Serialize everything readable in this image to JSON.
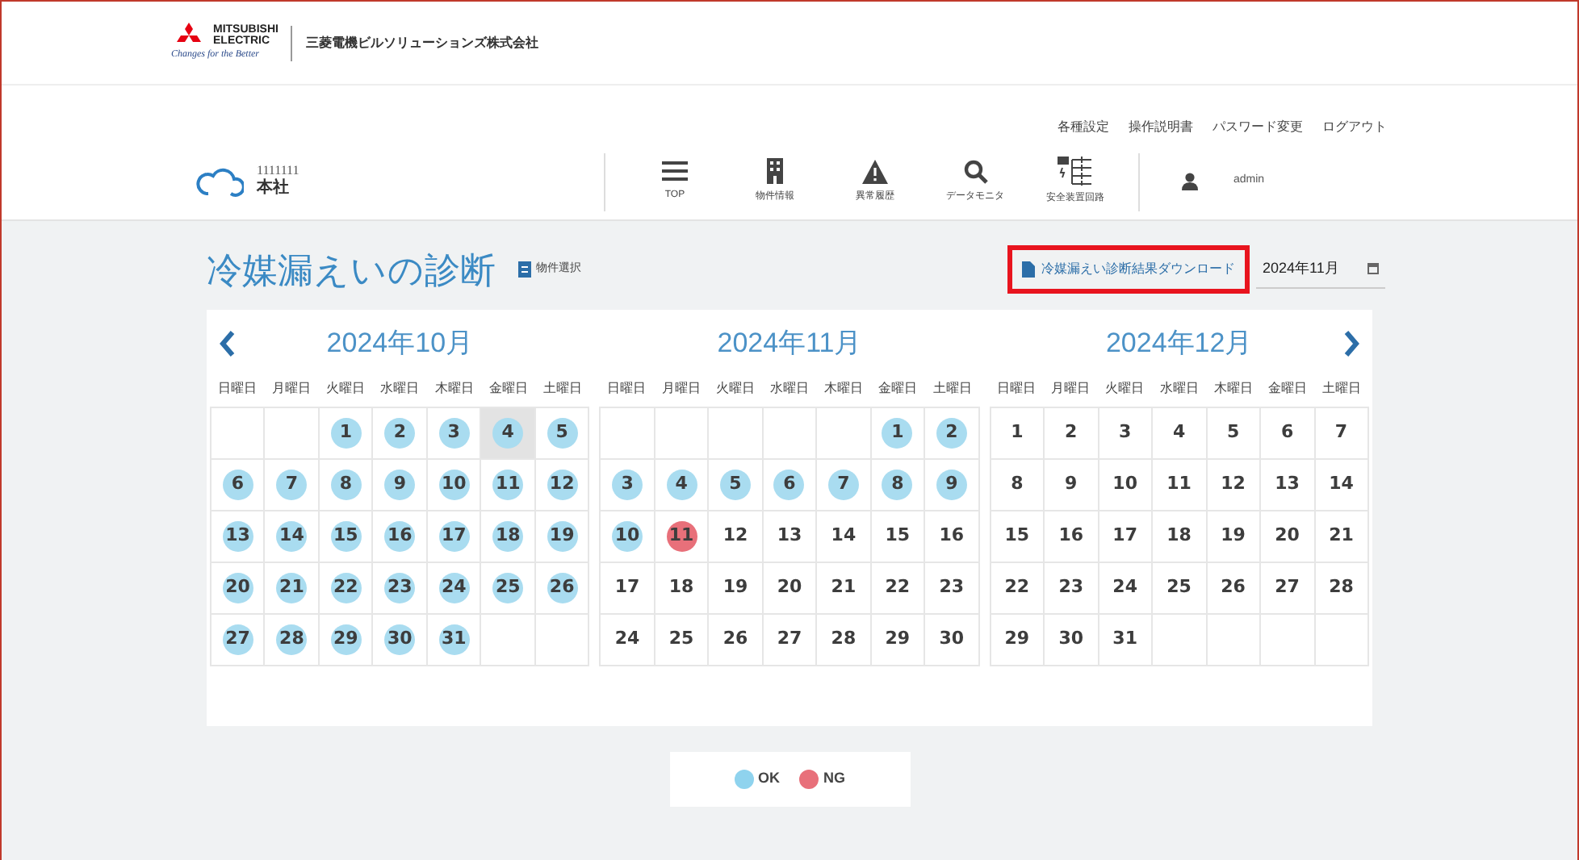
{
  "header": {
    "brand_line1": "MITSUBISHI",
    "brand_line2": "ELECTRIC",
    "tagline": "Changes for the Better",
    "company": "三菱電機ビルソリューションズ株式会社"
  },
  "top_links": [
    "各種設定",
    "操作説明書",
    "パスワード変更",
    "ログアウト"
  ],
  "site": {
    "code": "1111111",
    "name": "本社"
  },
  "nav": [
    {
      "label": "TOP",
      "kind": "menu"
    },
    {
      "label": "物件情報",
      "kind": "building"
    },
    {
      "label": "異常履歴",
      "kind": "alert"
    },
    {
      "label": "データモニタ",
      "kind": "search"
    },
    {
      "label": "安全装置回路",
      "kind": "circuit"
    }
  ],
  "user": "admin",
  "page_title": "冷媒漏えいの診断",
  "property_select": "物件選択",
  "download": "冷媒漏えい診断結果ダウンロード",
  "month_field": "2024年11月",
  "months": [
    {
      "title": "2024年10月",
      "weekdays": [
        "日曜日",
        "月曜日",
        "火曜日",
        "水曜日",
        "木曜日",
        "金曜日",
        "土曜日"
      ],
      "days": [
        {
          "kind": "blank",
          "selected": false
        },
        {
          "kind": "blank",
          "selected": false
        },
        {
          "d": "1",
          "kind": "ok",
          "selected": false
        },
        {
          "d": "2",
          "kind": "ok",
          "selected": false
        },
        {
          "d": "3",
          "kind": "ok",
          "selected": false
        },
        {
          "d": "4",
          "kind": "ok",
          "selected": true
        },
        {
          "d": "5",
          "kind": "ok",
          "selected": false
        },
        {
          "d": "6",
          "kind": "ok",
          "selected": false
        },
        {
          "d": "7",
          "kind": "ok",
          "selected": false
        },
        {
          "d": "8",
          "kind": "ok",
          "selected": false
        },
        {
          "d": "9",
          "kind": "ok",
          "selected": false
        },
        {
          "d": "10",
          "kind": "ok",
          "selected": false
        },
        {
          "d": "11",
          "kind": "ok",
          "selected": false
        },
        {
          "d": "12",
          "kind": "ok",
          "selected": false
        },
        {
          "d": "13",
          "kind": "ok",
          "selected": false
        },
        {
          "d": "14",
          "kind": "ok",
          "selected": false
        },
        {
          "d": "15",
          "kind": "ok",
          "selected": false
        },
        {
          "d": "16",
          "kind": "ok",
          "selected": false
        },
        {
          "d": "17",
          "kind": "ok",
          "selected": false
        },
        {
          "d": "18",
          "kind": "ok",
          "selected": false
        },
        {
          "d": "19",
          "kind": "ok",
          "selected": false
        },
        {
          "d": "20",
          "kind": "ok",
          "selected": false
        },
        {
          "d": "21",
          "kind": "ok",
          "selected": false
        },
        {
          "d": "22",
          "kind": "ok",
          "selected": false
        },
        {
          "d": "23",
          "kind": "ok",
          "selected": false
        },
        {
          "d": "24",
          "kind": "ok",
          "selected": false
        },
        {
          "d": "25",
          "kind": "ok",
          "selected": false
        },
        {
          "d": "26",
          "kind": "ok",
          "selected": false
        },
        {
          "d": "27",
          "kind": "ok",
          "selected": false
        },
        {
          "d": "28",
          "kind": "ok",
          "selected": false
        },
        {
          "d": "29",
          "kind": "ok",
          "selected": false
        },
        {
          "d": "30",
          "kind": "ok",
          "selected": false
        },
        {
          "d": "31",
          "kind": "ok",
          "selected": false
        }
      ]
    },
    {
      "title": "2024年11月",
      "weekdays": [
        "日曜日",
        "月曜日",
        "火曜日",
        "水曜日",
        "木曜日",
        "金曜日",
        "土曜日"
      ],
      "days": [
        {
          "kind": "blank",
          "selected": false
        },
        {
          "kind": "blank",
          "selected": false
        },
        {
          "kind": "blank",
          "selected": false
        },
        {
          "kind": "blank",
          "selected": false
        },
        {
          "kind": "blank",
          "selected": false
        },
        {
          "d": "1",
          "kind": "ok",
          "selected": false
        },
        {
          "d": "2",
          "kind": "ok",
          "selected": false
        },
        {
          "d": "3",
          "kind": "ok",
          "selected": false
        },
        {
          "d": "4",
          "kind": "ok",
          "selected": false
        },
        {
          "d": "5",
          "kind": "ok",
          "selected": false
        },
        {
          "d": "6",
          "kind": "ok",
          "selected": false
        },
        {
          "d": "7",
          "kind": "ok",
          "selected": false
        },
        {
          "d": "8",
          "kind": "ok",
          "selected": false
        },
        {
          "d": "9",
          "kind": "ok",
          "selected": false
        },
        {
          "d": "10",
          "kind": "ok",
          "selected": false
        },
        {
          "d": "11",
          "kind": "ng",
          "selected": false
        },
        {
          "d": "12",
          "kind": "plain",
          "selected": false
        },
        {
          "d": "13",
          "kind": "plain",
          "selected": false
        },
        {
          "d": "14",
          "kind": "plain",
          "selected": false
        },
        {
          "d": "15",
          "kind": "plain",
          "selected": false
        },
        {
          "d": "16",
          "kind": "plain",
          "selected": false
        },
        {
          "d": "17",
          "kind": "plain",
          "selected": false
        },
        {
          "d": "18",
          "kind": "plain",
          "selected": false
        },
        {
          "d": "19",
          "kind": "plain",
          "selected": false
        },
        {
          "d": "20",
          "kind": "plain",
          "selected": false
        },
        {
          "d": "21",
          "kind": "plain",
          "selected": false
        },
        {
          "d": "22",
          "kind": "plain",
          "selected": false
        },
        {
          "d": "23",
          "kind": "plain",
          "selected": false
        },
        {
          "d": "24",
          "kind": "plain",
          "selected": false
        },
        {
          "d": "25",
          "kind": "plain",
          "selected": false
        },
        {
          "d": "26",
          "kind": "plain",
          "selected": false
        },
        {
          "d": "27",
          "kind": "plain",
          "selected": false
        },
        {
          "d": "28",
          "kind": "plain",
          "selected": false
        },
        {
          "d": "29",
          "kind": "plain",
          "selected": false
        },
        {
          "d": "30",
          "kind": "plain",
          "selected": false
        }
      ]
    },
    {
      "title": "2024年12月",
      "weekdays": [
        "日曜日",
        "月曜日",
        "火曜日",
        "水曜日",
        "木曜日",
        "金曜日",
        "土曜日"
      ],
      "days": [
        {
          "d": "1",
          "kind": "plain",
          "selected": false
        },
        {
          "d": "2",
          "kind": "plain",
          "selected": false
        },
        {
          "d": "3",
          "kind": "plain",
          "selected": false
        },
        {
          "d": "4",
          "kind": "plain",
          "selected": false
        },
        {
          "d": "5",
          "kind": "plain",
          "selected": false
        },
        {
          "d": "6",
          "kind": "plain",
          "selected": false
        },
        {
          "d": "7",
          "kind": "plain",
          "selected": false
        },
        {
          "d": "8",
          "kind": "plain",
          "selected": false
        },
        {
          "d": "9",
          "kind": "plain",
          "selected": false
        },
        {
          "d": "10",
          "kind": "plain",
          "selected": false
        },
        {
          "d": "11",
          "kind": "plain",
          "selected": false
        },
        {
          "d": "12",
          "kind": "plain",
          "selected": false
        },
        {
          "d": "13",
          "kind": "plain",
          "selected": false
        },
        {
          "d": "14",
          "kind": "plain",
          "selected": false
        },
        {
          "d": "15",
          "kind": "plain",
          "selected": false
        },
        {
          "d": "16",
          "kind": "plain",
          "selected": false
        },
        {
          "d": "17",
          "kind": "plain",
          "selected": false
        },
        {
          "d": "18",
          "kind": "plain",
          "selected": false
        },
        {
          "d": "19",
          "kind": "plain",
          "selected": false
        },
        {
          "d": "20",
          "kind": "plain",
          "selected": false
        },
        {
          "d": "21",
          "kind": "plain",
          "selected": false
        },
        {
          "d": "22",
          "kind": "plain",
          "selected": false
        },
        {
          "d": "23",
          "kind": "plain",
          "selected": false
        },
        {
          "d": "24",
          "kind": "plain",
          "selected": false
        },
        {
          "d": "25",
          "kind": "plain",
          "selected": false
        },
        {
          "d": "26",
          "kind": "plain",
          "selected": false
        },
        {
          "d": "27",
          "kind": "plain",
          "selected": false
        },
        {
          "d": "28",
          "kind": "plain",
          "selected": false
        },
        {
          "d": "29",
          "kind": "plain",
          "selected": false
        },
        {
          "d": "30",
          "kind": "plain",
          "selected": false
        },
        {
          "d": "31",
          "kind": "plain",
          "selected": false
        }
      ]
    }
  ],
  "legend": [
    {
      "label": "OK",
      "color": "#8fd3ee"
    },
    {
      "label": "NG",
      "color": "#e8707a"
    }
  ]
}
